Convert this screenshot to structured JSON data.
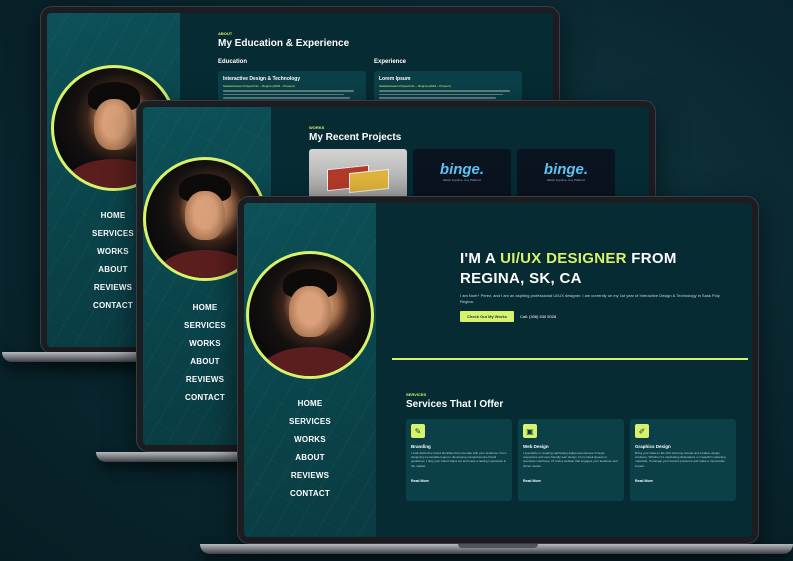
{
  "nav": {
    "items": [
      "HOME",
      "SERVICES",
      "WORKS",
      "ABOUT",
      "REVIEWS",
      "CONTACT"
    ]
  },
  "screen1": {
    "eyebrow": "ABOUT",
    "title": "My Education & Experience",
    "col1": "Education",
    "col2": "Experience",
    "card1_title": "Interactive Design & Technology",
    "card1_sub": "Saskatchewan Polytechnic – Regina (2023 – Present)",
    "card2_title": "Lorem Ipsum",
    "card2_sub": "Saskatchewan Polytechnic – Regina (2024 – Present)"
  },
  "screen2": {
    "eyebrow": "WORKS",
    "title": "My Recent Projects",
    "binge": "binge.",
    "binge_sub": "Watch Anytime, Any Platform"
  },
  "screen3": {
    "hero_prefix": "I'M A ",
    "hero_highlight": "UI/UX DESIGNER",
    "hero_suffix": " FROM",
    "hero_line2": "REGINA, SK, CA",
    "hero_desc": "I am Noel+ Perez, and I am an aspiring professional UI/UX designer. I am currently on my 1st year of Interactive Design & Technology in Sask Poly Regina.",
    "cta_label": "Check Out My Works",
    "call_label": "Call: (306) 530 5028",
    "services_eyebrow": "SERVICES",
    "services_title": "Services That I Offer",
    "services": [
      {
        "icon": "✎",
        "title": "Branding",
        "desc": "I craft distinctive brand identities that resonate with your audience. From designing memorable logos to developing comprehensive brand guidelines, I help your brand stand out and leave a lasting impression in the market.",
        "link": "Read More"
      },
      {
        "icon": "▣",
        "title": "Web Design",
        "desc": "I specialize in creating captivating digital experiences through responsive and user-friendly web design. From sleek layouts to seamless interfaces, I'll craft a website that engages your audience and drives results.",
        "link": "Read More"
      },
      {
        "icon": "✐",
        "title": "Graphics Design",
        "desc": "Bring your ideas to life with stunning visuals and creative design solutions. Whether it's captivating illustrations or impactful marketing materials, I'll elevate your brand's presence and make a memorable impact.",
        "link": "Read More"
      }
    ]
  },
  "colors": {
    "accent": "#d9f26b",
    "background": "#062b33",
    "sidebar": "#0a434a",
    "card": "#0b4048"
  }
}
